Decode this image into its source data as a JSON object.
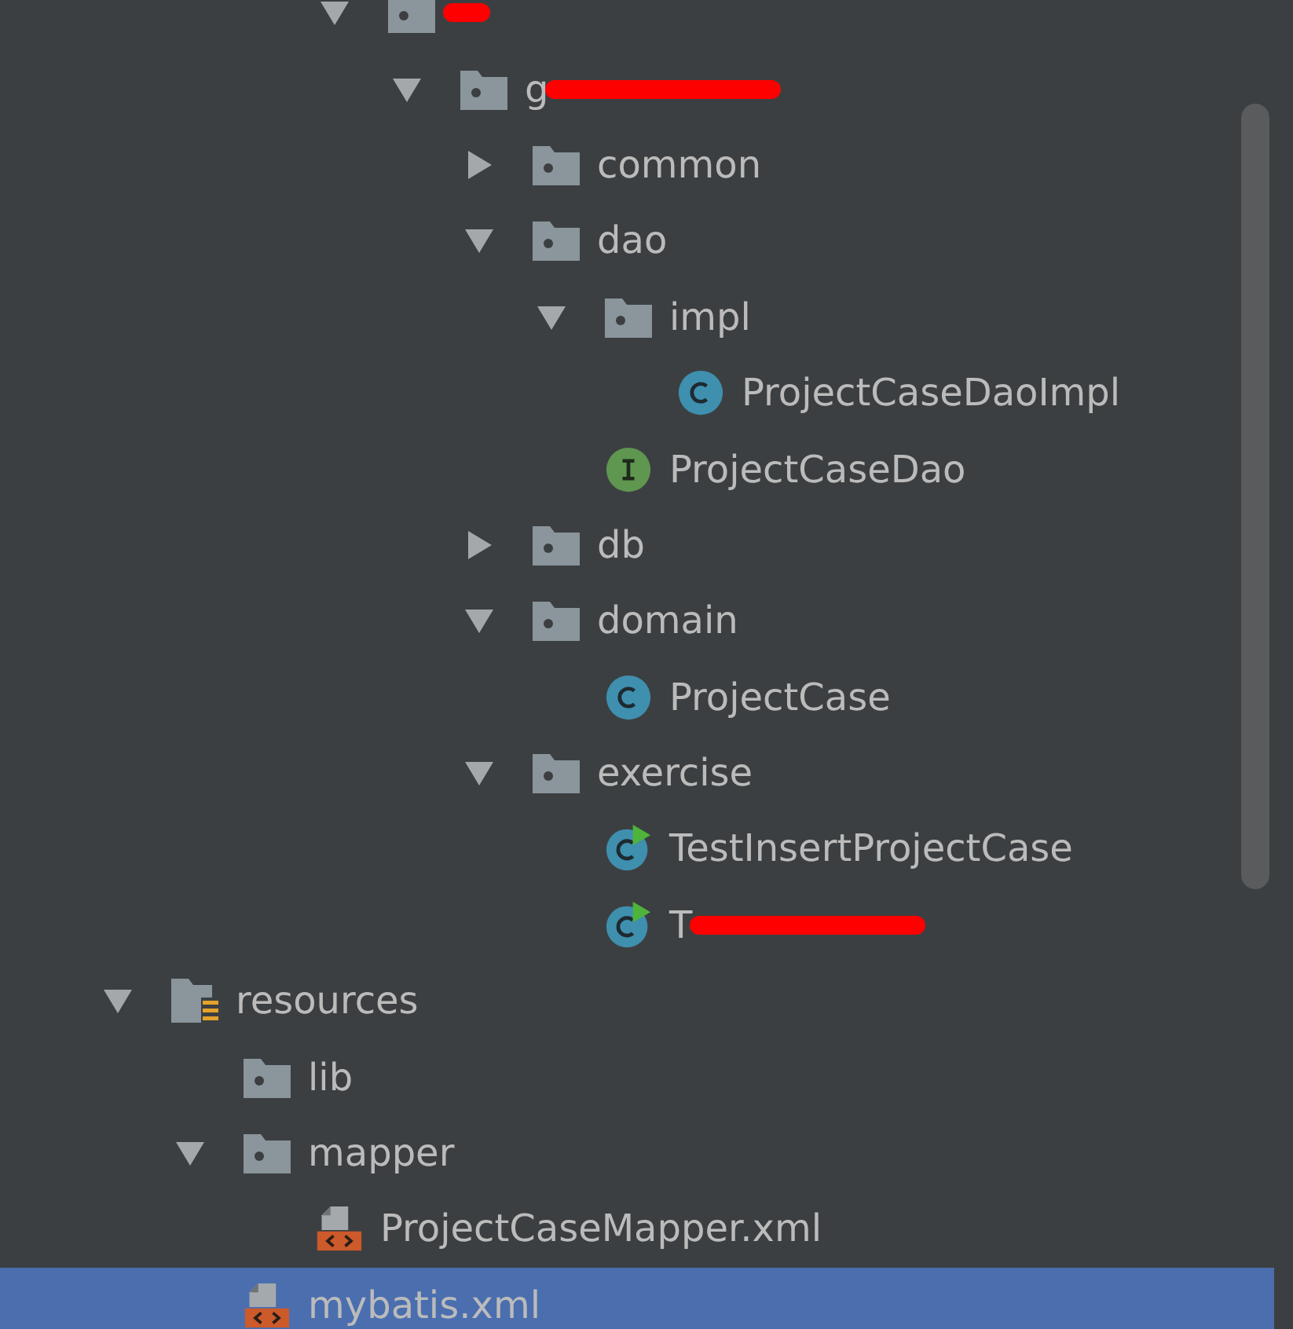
{
  "tree": [
    {
      "kind": "offscreen",
      "children": [
        {
          "kind": "offscreen",
          "children": [
            {
              "kind": "offscreen",
              "children": [
                {
                  "kind": "package",
                  "expanded": true,
                  "selected": false,
                  "redacted": true,
                  "children": [
                    {
                      "kind": "package",
                      "name": "g",
                      "expanded": true,
                      "selected": false,
                      "redacted": true,
                      "children": [
                        {
                          "kind": "package",
                          "name": "common",
                          "expanded": false,
                          "selected": false
                        },
                        {
                          "kind": "package",
                          "name": "dao",
                          "expanded": true,
                          "selected": false,
                          "children": [
                            {
                              "kind": "package",
                              "name": "impl",
                              "expanded": true,
                              "selected": false,
                              "children": [
                                {
                                  "kind": "class",
                                  "name": "ProjectCaseDaoImpl",
                                  "selected": false
                                }
                              ]
                            },
                            {
                              "kind": "interface",
                              "name": "ProjectCaseDao",
                              "selected": false
                            }
                          ]
                        },
                        {
                          "kind": "package",
                          "name": "db",
                          "expanded": false,
                          "selected": false
                        },
                        {
                          "kind": "package",
                          "name": "domain",
                          "expanded": true,
                          "selected": false,
                          "children": [
                            {
                              "kind": "class",
                              "name": "ProjectCase",
                              "selected": false
                            }
                          ]
                        },
                        {
                          "kind": "package",
                          "name": "exercise",
                          "expanded": true,
                          "selected": false,
                          "children": [
                            {
                              "kind": "test_class",
                              "name": "TestInsertProjectCase",
                              "selected": false
                            },
                            {
                              "kind": "test_class",
                              "name": "T",
                              "selected": false,
                              "redacted": true
                            }
                          ]
                        }
                      ]
                    }
                  ]
                }
              ]
            }
          ]
        }
      ]
    },
    {
      "kind": "resources",
      "name": "resources",
      "expanded": true,
      "selected": false,
      "children": [
        {
          "kind": "package",
          "name": "lib",
          "selected": false
        },
        {
          "kind": "package",
          "name": "mapper",
          "expanded": true,
          "selected": false,
          "children": [
            {
              "kind": "xml",
              "name": "ProjectCaseMapper.xml",
              "selected": false
            }
          ]
        },
        {
          "kind": "xml",
          "name": "mybatis.xml",
          "selected": true
        }
      ]
    }
  ]
}
